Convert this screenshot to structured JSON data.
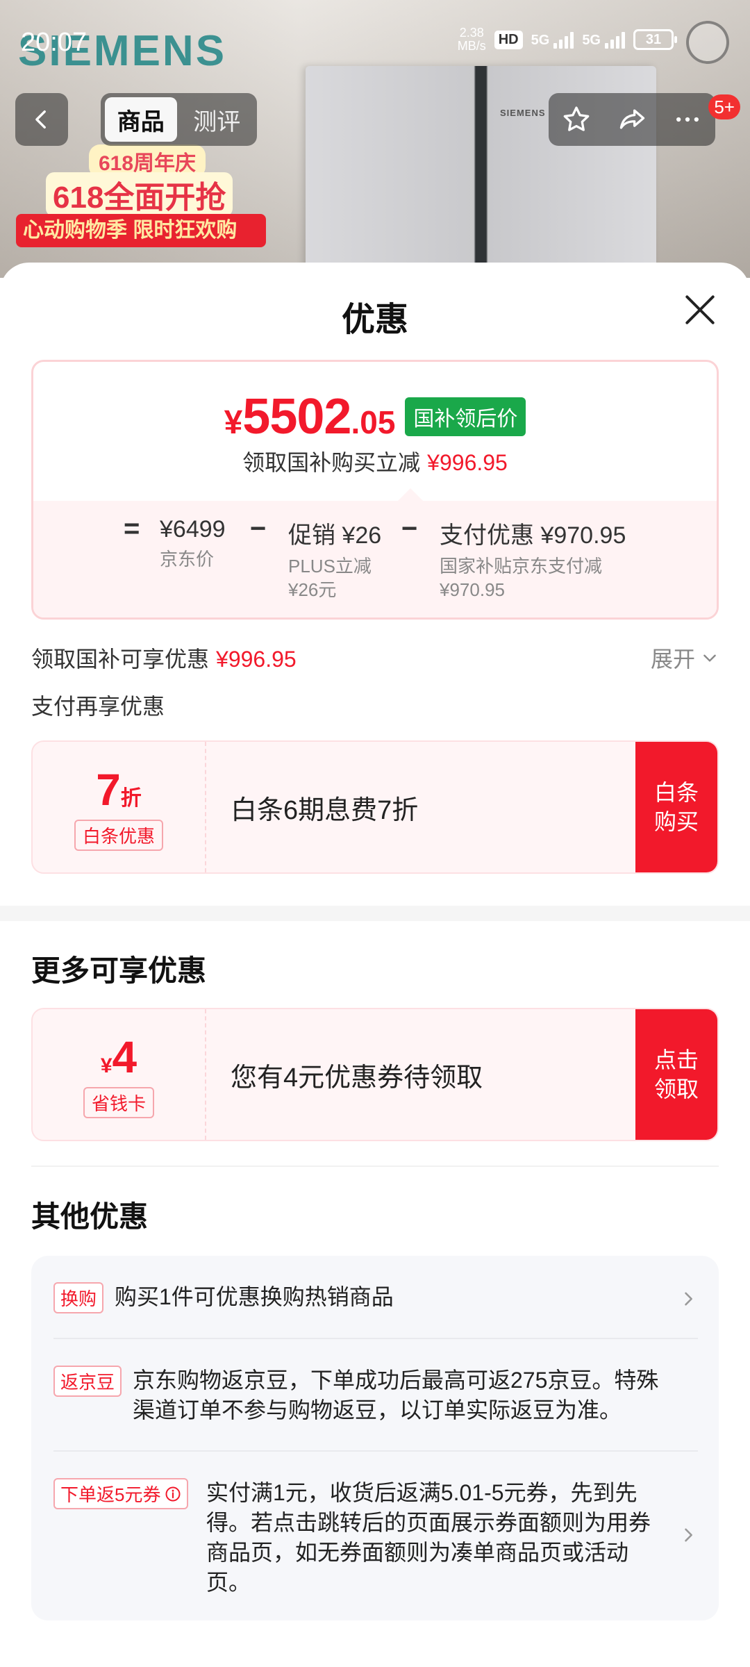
{
  "status_bar": {
    "time": "20:07",
    "speed_value": "2.38",
    "speed_unit": "MB/s",
    "hd_label": "HD",
    "sim1": "5G",
    "sim2": "5G",
    "battery": "31"
  },
  "background": {
    "brand": "SIEMENS",
    "fridge_brand": "SIEMENS",
    "promo_small": "618周年庆",
    "promo_big": "618全面开抢",
    "promo_strip": "心动购物季 限时狂欢购"
  },
  "top_nav": {
    "tabs": [
      {
        "label": "商品",
        "active": true
      },
      {
        "label": "测评",
        "active": false
      }
    ],
    "message_badge": "5+"
  },
  "sheet": {
    "title": "优惠",
    "price_card": {
      "yen": "¥",
      "price_integer": "5502",
      "price_decimal": ".05",
      "price_tag": "国补领后价",
      "subtitle": "领取国补购买立减",
      "subtitle_amount": "¥996.95",
      "equals": "=",
      "jd_price": "¥6499",
      "jd_price_label": "京东价",
      "minus1": "−",
      "promo": "促销 ¥26",
      "promo_detail1": "PLUS立减",
      "promo_detail2": "¥26元",
      "minus2": "−",
      "pay_discount": "支付优惠 ¥970.95",
      "pay_detail1": "国家补贴京东支付减",
      "pay_detail2": "¥970.95"
    },
    "subsidy_line": {
      "label": "领取国补可享优惠",
      "amount": "¥996.95",
      "expand": "展开"
    },
    "pay_more_title": "支付再享优惠",
    "baitiao_coupon": {
      "value": "7",
      "unit": "折",
      "tag": "白条优惠",
      "text": "白条6期息费7折",
      "button": "白条购买"
    },
    "more_title": "更多可享优惠",
    "save_card_coupon": {
      "currency": "¥",
      "value": "4",
      "tag": "省钱卡",
      "text": "您有4元优惠券待领取",
      "button": "点击领取"
    },
    "other_title": "其他优惠",
    "other_items": [
      {
        "tag": "换购",
        "text": "购买1件可优惠换购热销商品"
      },
      {
        "tag": "返京豆",
        "text": "京东购物返京豆，下单成功后最高可返275京豆。特殊渠道订单不参与购物返豆，以订单实际返豆为准。"
      },
      {
        "tag": "下单返5元券",
        "text": "实付满1元，收货后返满5.01-5元券，先到先得。若点击跳转后的页面展示券面额则为用券商品页，如无券面额则为凑单商品页或活动页。"
      }
    ]
  },
  "colors": {
    "price_red": "#f2192b",
    "tag_green": "#1aa84a",
    "sheet_bg": "#ffffff"
  }
}
